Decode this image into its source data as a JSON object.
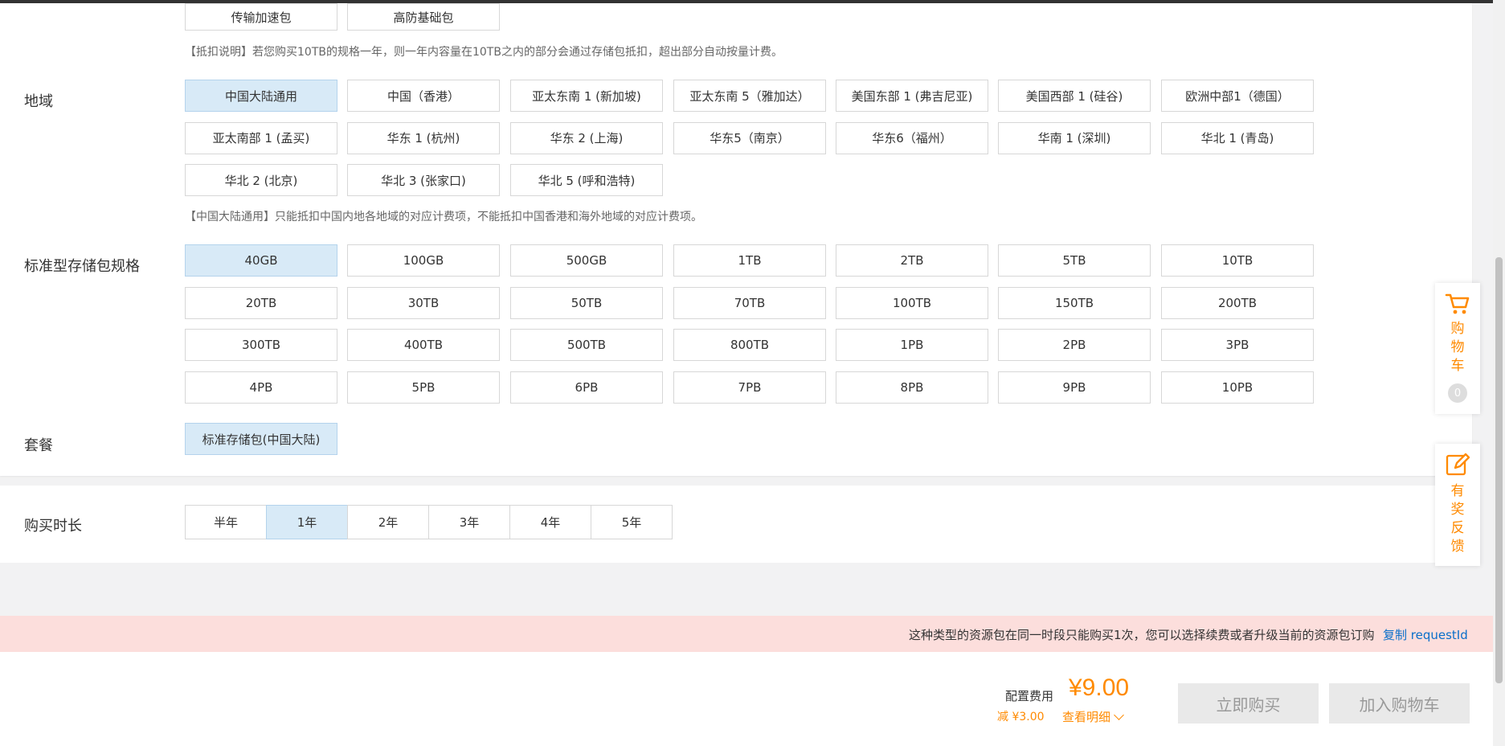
{
  "top_partial_options": [
    "传输加速包",
    "高防基础包"
  ],
  "deduction_note": "【抵扣说明】若您购买10TB的规格一年，则一年内容量在10TB之内的部分会通过存储包抵扣，超出部分自动按量计费。",
  "region": {
    "label": "地域",
    "options": [
      "中国大陆通用",
      "中国（香港）",
      "亚太东南 1 (新加坡)",
      "亚太东南 5（雅加达）",
      "美国东部 1 (弗吉尼亚)",
      "美国西部 1 (硅谷)",
      "欧洲中部1（德国）",
      "亚太南部 1 (孟买)",
      "华东 1 (杭州)",
      "华东 2 (上海)",
      "华东5（南京）",
      "华东6（福州）",
      "华南 1 (深圳)",
      "华北 1 (青岛)",
      "华北 2 (北京)",
      "华北 3 (张家口)",
      "华北 5 (呼和浩特)"
    ],
    "selected": "中国大陆通用",
    "note": "【中国大陆通用】只能抵扣中国内地各地域的对应计费项，不能抵扣中国香港和海外地域的对应计费项。"
  },
  "spec": {
    "label": "标准型存储包规格",
    "options": [
      "40GB",
      "100GB",
      "500GB",
      "1TB",
      "2TB",
      "5TB",
      "10TB",
      "20TB",
      "30TB",
      "50TB",
      "70TB",
      "100TB",
      "150TB",
      "200TB",
      "300TB",
      "400TB",
      "500TB",
      "800TB",
      "1PB",
      "2PB",
      "3PB",
      "4PB",
      "5PB",
      "6PB",
      "7PB",
      "8PB",
      "9PB",
      "10PB"
    ],
    "selected": "40GB"
  },
  "package": {
    "label": "套餐",
    "options": [
      "标准存储包(中国大陆)"
    ],
    "selected": "标准存储包(中国大陆)"
  },
  "duration": {
    "label": "购买时长",
    "options": [
      "半年",
      "1年",
      "2年",
      "3年",
      "4年",
      "5年"
    ],
    "selected": "1年"
  },
  "warning": {
    "text": "这种类型的资源包在同一时段只能购买1次，您可以选择续费或者升级当前的资源包订购",
    "copy_link": "复制 requestId"
  },
  "footer": {
    "fee_label": "配置费用",
    "price": "¥9.00",
    "discount": "减 ¥3.00",
    "detail_link": "查看明细",
    "buy_now": "立即购买",
    "add_to_cart": "加入购物车"
  },
  "sidebar": {
    "cart_label": "购物车",
    "cart_count": "0",
    "feedback_label": "有奖反馈"
  },
  "colors": {
    "accent_orange": "#ff8a00",
    "selected_bg": "#d8eaf7",
    "warn_bg": "#fcdedc",
    "link_blue": "#0a6fca"
  }
}
